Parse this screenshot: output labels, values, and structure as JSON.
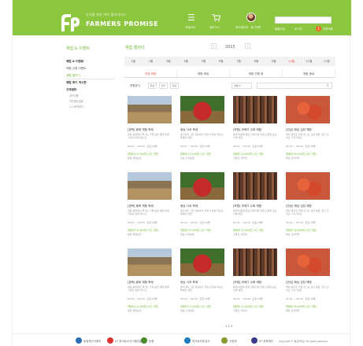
{
  "header": {
    "brand_small": "당신을 위한 약속 팜프라미스",
    "brand": "FARMERS PROMISE",
    "nav": [
      {
        "icon": "menu-icon",
        "label": "카테고리"
      },
      {
        "icon": "cart-icon",
        "label": "장바구니"
      }
    ],
    "user_label": "마이페이지 · 로그아웃",
    "login_links": [
      "회원가입",
      "로그인",
      "주문조회"
    ],
    "login_badge": "1"
  },
  "sidebar": {
    "title": "체험 & 이벤트",
    "items": [
      {
        "label": "체험 & 이벤트",
        "style": "bold"
      },
      {
        "label": "체험 신청 이벤트",
        "style": ""
      },
      {
        "label": "체험 캘린더",
        "style": "active",
        "arrow": "›"
      },
      {
        "label": "체험 후기 게시판",
        "style": "bold"
      },
      {
        "label": "고객센터",
        "style": "bold"
      }
    ],
    "subs": [
      "공지사항",
      "자주묻는질문",
      "1:1 문의하기"
    ]
  },
  "calendar": {
    "title": "체험 캘린더",
    "year": "2015",
    "prev": "‹",
    "next": "›",
    "months": [
      "1월",
      "2월",
      "3월",
      "4월",
      "5월",
      "6월",
      "7월",
      "8월",
      "9월",
      "10월",
      "11월",
      "12월"
    ],
    "active_month": 9,
    "tabs": [
      "전체 체험",
      "체험 예정",
      "체험 진행 중",
      "체험 종료"
    ],
    "active_tab": 0
  },
  "filter": {
    "label": "정렬방식",
    "buttons": [
      "최신",
      "인기",
      "마감"
    ],
    "select": "전체",
    "search_icon": "search-icon"
  },
  "cards": [
    {
      "img": "field",
      "title": "[경북] 봉화 체험 축제",
      "desc": "경북 봉화에서 즐기는 가을 농촌 체험 축제. 가족과 함께 떠나요.",
      "meta": "09.21 ~ 09.30 · 모집 20명",
      "price": "체험비 10,000원 (1인 기준)",
      "seller": "봉화 체험농장"
    },
    {
      "img": "apple",
      "title": "청송 사과 축제",
      "desc": "꿀사과의 고장 청송에서 직접 사과를 따보는 특별한 체험.",
      "meta": "09.21 ~ 09.30 · 모집 20명",
      "price": "체험비 15,000원 (1인 기준)",
      "seller": "청송 사과농원"
    },
    {
      "img": "fish",
      "title": "[포항] 과메기 수확 체험",
      "desc": "동해 바람에 말린 과메기를 직접 손질해 보는 수확 체험.",
      "meta": "09.21 ~ 09.30 · 모집 20명",
      "price": "체험비 20,000원 (1인 기준)",
      "seller": "구룡포 어촌계"
    },
    {
      "img": "kimchi",
      "title": "[전남] 해남 김장 체험",
      "desc": "해남 배추로 직접 담그는 김장 체험. 담근 김치는 가져가세요.",
      "meta": "09.21 ~ 09.30 · 모집 20명",
      "price": "체험비 30,000원 (1인 기준)",
      "seller": "해남 김치마을"
    },
    {
      "img": "field",
      "title": "[경북] 봉화 체험 축제",
      "desc": "경북 봉화에서 즐기는 가을 농촌 체험 축제. 가족과 함께 떠나요.",
      "meta": "09.21 ~ 09.30 · 모집 20명",
      "price": "체험비 10,000원 (1인 기준)",
      "seller": "봉화 체험농장"
    },
    {
      "img": "apple",
      "title": "청송 사과 축제",
      "desc": "꿀사과의 고장 청송에서 직접 사과를 따보는 특별한 체험.",
      "meta": "09.21 ~ 09.30 · 모집 20명",
      "price": "체험비 15,000원 (1인 기준)",
      "seller": "청송 사과농원"
    },
    {
      "img": "fish",
      "title": "[포항] 과메기 수확 체험",
      "desc": "동해 바람에 말린 과메기를 직접 손질해 보는 수확 체험.",
      "meta": "09.21 ~ 09.30 · 모집 20명",
      "price": "체험비 20,000원 (1인 기준)",
      "seller": "구룡포 어촌계"
    },
    {
      "img": "kimchi",
      "title": "[전남] 해남 김장 체험",
      "desc": "해남 배추로 직접 담그는 김장 체험. 담근 김치는 가져가세요.",
      "meta": "09.21 ~ 09.30 · 모집 20명",
      "price": "체험비 30,000원 (1인 기준)",
      "seller": "해남 김치마을"
    },
    {
      "img": "field",
      "title": "[경북] 봉화 체험 축제",
      "desc": "경북 봉화에서 즐기는 가을 농촌 체험 축제. 가족과 함께 떠나요.",
      "meta": "09.21 ~ 09.30 · 모집 20명",
      "price": "체험비 10,000원 (1인 기준)",
      "seller": "봉화 체험농장"
    },
    {
      "img": "apple",
      "title": "청송 사과 축제",
      "desc": "꿀사과의 고장 청송에서 직접 사과를 따보는 특별한 체험.",
      "meta": "09.21 ~ 09.30 · 모집 20명",
      "price": "체험비 15,000원 (1인 기준)",
      "seller": "청송 사과농원"
    },
    {
      "img": "fish",
      "title": "[포항] 과메기 수확 체험",
      "desc": "동해 바람에 말린 과메기를 직접 손질해 보는 수확 체험.",
      "meta": "09.21 ~ 09.30 · 모집 20명",
      "price": "체험비 20,000원 (1인 기준)",
      "seller": "구룡포 어촌계"
    },
    {
      "img": "kimchi",
      "title": "[전남] 해남 김장 체험",
      "desc": "해남 배추로 직접 담그는 김장 체험. 담근 김치는 가져가세요.",
      "meta": "09.21 ~ 09.30 · 모집 20명",
      "price": "체험비 30,000원 (1인 기준)",
      "seller": "해남 김치마을"
    }
  ],
  "pager": "1 2 3",
  "footer": {
    "partners": [
      "농림축산식품부",
      "aT 한국농수산식품유통공사",
      "농협",
      "한국농어촌공사",
      "산림청",
      "KT 문화재단"
    ],
    "copyright": "Copyright © 팜프라미스 All rights reserved."
  },
  "colors": {
    "brand_green": "#8cc63f",
    "accent_red": "#e5533d",
    "price_green": "#76b83a"
  }
}
